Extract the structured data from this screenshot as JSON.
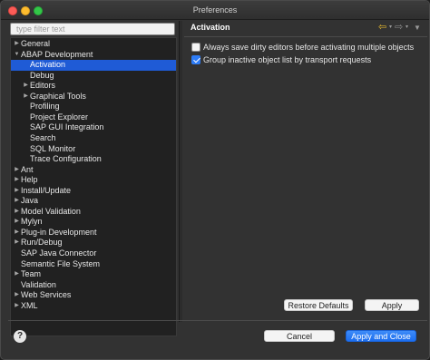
{
  "window": {
    "title": "Preferences"
  },
  "filter": {
    "placeholder": "type filter text"
  },
  "tree": [
    {
      "label": "General",
      "has_children": true,
      "expanded": false,
      "level": 0,
      "selected": false
    },
    {
      "label": "ABAP Development",
      "has_children": true,
      "expanded": true,
      "level": 0,
      "selected": false
    },
    {
      "label": "Activation",
      "has_children": false,
      "expanded": false,
      "level": 1,
      "selected": true
    },
    {
      "label": "Debug",
      "has_children": false,
      "expanded": false,
      "level": 1,
      "selected": false
    },
    {
      "label": "Editors",
      "has_children": true,
      "expanded": false,
      "level": 1,
      "selected": false
    },
    {
      "label": "Graphical Tools",
      "has_children": true,
      "expanded": false,
      "level": 1,
      "selected": false
    },
    {
      "label": "Profiling",
      "has_children": false,
      "expanded": false,
      "level": 1,
      "selected": false
    },
    {
      "label": "Project Explorer",
      "has_children": false,
      "expanded": false,
      "level": 1,
      "selected": false
    },
    {
      "label": "SAP GUI Integration",
      "has_children": false,
      "expanded": false,
      "level": 1,
      "selected": false
    },
    {
      "label": "Search",
      "has_children": false,
      "expanded": false,
      "level": 1,
      "selected": false
    },
    {
      "label": "SQL Monitor",
      "has_children": false,
      "expanded": false,
      "level": 1,
      "selected": false
    },
    {
      "label": "Trace Configuration",
      "has_children": false,
      "expanded": false,
      "level": 1,
      "selected": false
    },
    {
      "label": "Ant",
      "has_children": true,
      "expanded": false,
      "level": 0,
      "selected": false
    },
    {
      "label": "Help",
      "has_children": true,
      "expanded": false,
      "level": 0,
      "selected": false
    },
    {
      "label": "Install/Update",
      "has_children": true,
      "expanded": false,
      "level": 0,
      "selected": false
    },
    {
      "label": "Java",
      "has_children": true,
      "expanded": false,
      "level": 0,
      "selected": false
    },
    {
      "label": "Model Validation",
      "has_children": true,
      "expanded": false,
      "level": 0,
      "selected": false
    },
    {
      "label": "Mylyn",
      "has_children": true,
      "expanded": false,
      "level": 0,
      "selected": false
    },
    {
      "label": "Plug-in Development",
      "has_children": true,
      "expanded": false,
      "level": 0,
      "selected": false
    },
    {
      "label": "Run/Debug",
      "has_children": true,
      "expanded": false,
      "level": 0,
      "selected": false
    },
    {
      "label": "SAP Java Connector",
      "has_children": false,
      "expanded": false,
      "level": 0,
      "selected": false
    },
    {
      "label": "Semantic File System",
      "has_children": false,
      "expanded": false,
      "level": 0,
      "selected": false
    },
    {
      "label": "Team",
      "has_children": true,
      "expanded": false,
      "level": 0,
      "selected": false
    },
    {
      "label": "Validation",
      "has_children": false,
      "expanded": false,
      "level": 0,
      "selected": false
    },
    {
      "label": "Web Services",
      "has_children": true,
      "expanded": false,
      "level": 0,
      "selected": false
    },
    {
      "label": "XML",
      "has_children": true,
      "expanded": false,
      "level": 0,
      "selected": false
    }
  ],
  "page": {
    "title": "Activation",
    "nav": {
      "back_icon": "back-arrow-icon",
      "forward_icon": "forward-arrow-icon",
      "menu_icon": "view-menu-icon"
    },
    "options": [
      {
        "label": "Always save dirty editors before activating multiple objects",
        "checked": false
      },
      {
        "label": "Group inactive object list by transport requests",
        "checked": true
      }
    ],
    "restore_defaults_label": "Restore Defaults",
    "apply_label": "Apply"
  },
  "footer": {
    "help_icon": "help-icon",
    "help_glyph": "?",
    "cancel_label": "Cancel",
    "apply_close_label": "Apply and Close"
  },
  "colors": {
    "selection": "#1f5bd6",
    "primary_button": "#2d7cf6",
    "nav_back_arrow": "#e5b830"
  }
}
